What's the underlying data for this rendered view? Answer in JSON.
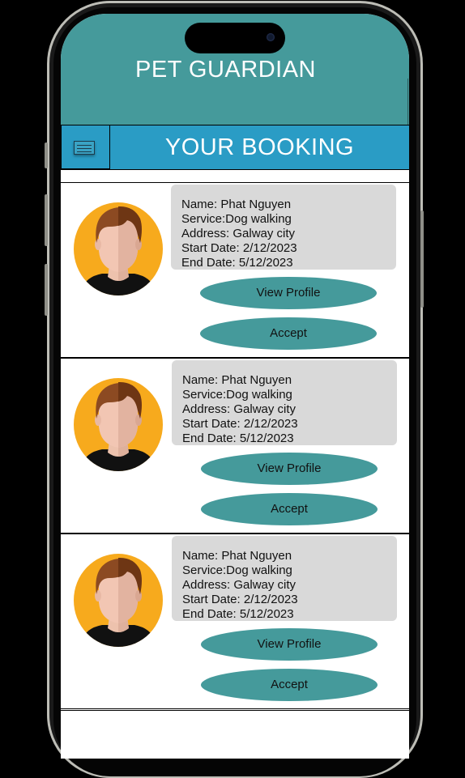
{
  "header": {
    "app_title": "PET GUARDIAN"
  },
  "bar": {
    "title": "YOUR BOOKING",
    "menu_icon": "hamburger-menu-icon"
  },
  "bookings": [
    {
      "name": "Name: Phat Nguyen",
      "service": "Service:Dog walking",
      "address": "Address: Galway city",
      "start": "Start Date: 2/12/2023",
      "end": "End Date: 5/12/2023",
      "view_label": "View Profile",
      "accept_label": "Accept"
    },
    {
      "name": "Name: Phat Nguyen",
      "service": "Service:Dog walking",
      "address": "Address: Galway city",
      "start": "Start Date: 2/12/2023",
      "end": "End Date: 5/12/2023",
      "view_label": "View Profile",
      "accept_label": "Accept"
    },
    {
      "name": "Name: Phat Nguyen",
      "service": "Service:Dog walking",
      "address": "Address: Galway city",
      "start": "Start Date: 2/12/2023",
      "end": "End Date: 5/12/2023",
      "view_label": "View Profile",
      "accept_label": "Accept"
    }
  ],
  "colors": {
    "header": "#459a9b",
    "bar": "#2a9cc5",
    "button": "#459a9b",
    "info_box": "#d9d9d9",
    "avatar_bg": "#f7aa1d"
  }
}
